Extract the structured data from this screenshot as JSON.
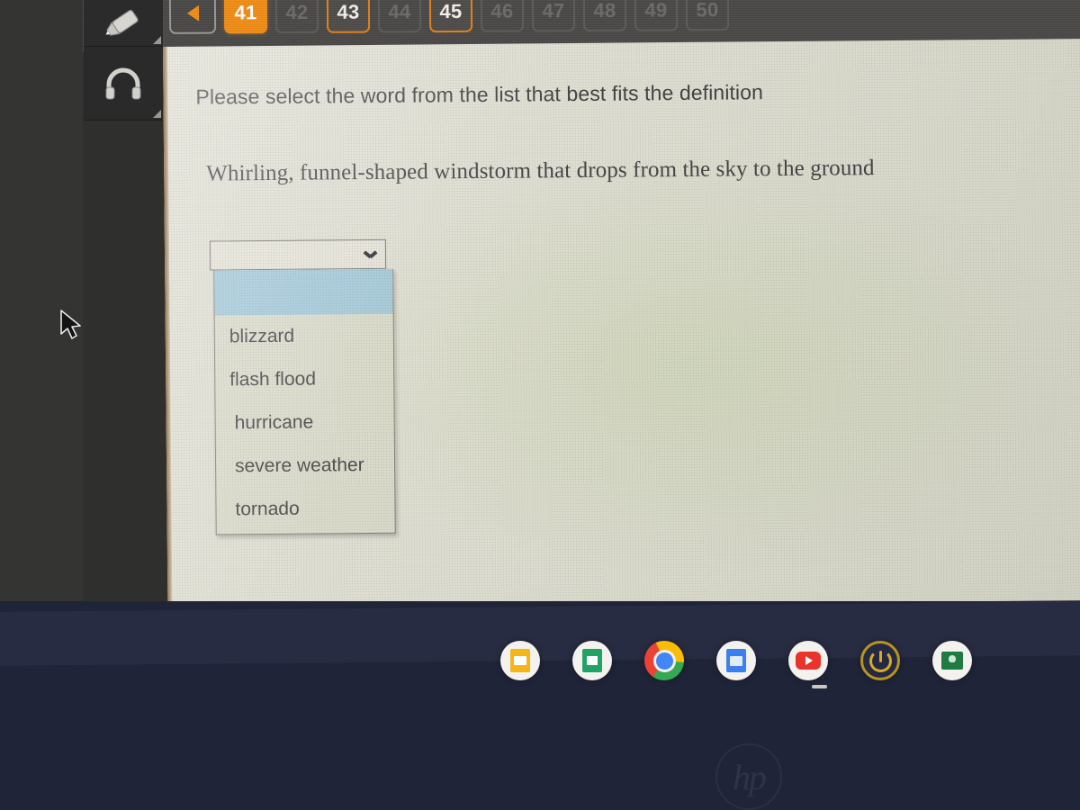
{
  "quiz_nav": {
    "back_label": "◀",
    "back_icon": "back-triangle-icon",
    "buttons": [
      {
        "label": "41",
        "state": "answered"
      },
      {
        "label": "42",
        "state": "dim"
      },
      {
        "label": "43",
        "state": "current-outline"
      },
      {
        "label": "44",
        "state": "dim"
      },
      {
        "label": "45",
        "state": "current-outline"
      },
      {
        "label": "46",
        "state": "dim"
      },
      {
        "label": "47",
        "state": "dim"
      },
      {
        "label": "48",
        "state": "dim"
      },
      {
        "label": "49",
        "state": "dim"
      },
      {
        "label": "50",
        "state": "dim"
      }
    ],
    "accent_color": "#ef8c16",
    "strip_color": "#4a4947"
  },
  "toolbar": {
    "items": [
      {
        "icon": "highlighter-pen-icon",
        "name": "highlighter-tool"
      },
      {
        "icon": "headphones-icon",
        "name": "text-to-speech-tool"
      }
    ]
  },
  "question": {
    "prompt": "Please select the word from the list that best fits the definition",
    "definition": "Whirling, funnel-shaped windstorm that drops from the sky to the ground"
  },
  "dropdown": {
    "name": "answer-select",
    "selected_value": "",
    "expanded": true,
    "chevron_icon": "chevron-down-icon",
    "highlight_color": "#9ec6d8",
    "options": [
      {
        "label": "",
        "blank": true,
        "highlighted": true
      },
      {
        "label": "blizzard",
        "blank": false,
        "highlighted": false
      },
      {
        "label": "flash flood",
        "blank": false,
        "highlighted": false
      },
      {
        "label": "hurricane",
        "blank": false,
        "highlighted": false
      },
      {
        "label": "severe weather",
        "blank": false,
        "highlighted": false
      },
      {
        "label": "tornado",
        "blank": false,
        "highlighted": false
      }
    ]
  },
  "shelf": {
    "background_color": "#1f2438",
    "icons": [
      {
        "name": "google-slides-icon",
        "label": "Google Slides"
      },
      {
        "name": "google-sheets-icon",
        "label": "Google Sheets"
      },
      {
        "name": "chrome-icon",
        "label": "Google Chrome"
      },
      {
        "name": "google-docs-icon",
        "label": "Google Docs"
      },
      {
        "name": "youtube-icon",
        "label": "YouTube"
      },
      {
        "name": "power-icon",
        "label": "Power"
      },
      {
        "name": "google-classroom-icon",
        "label": "Google Classroom"
      }
    ]
  },
  "bezel": {
    "logo_text": "hp"
  }
}
